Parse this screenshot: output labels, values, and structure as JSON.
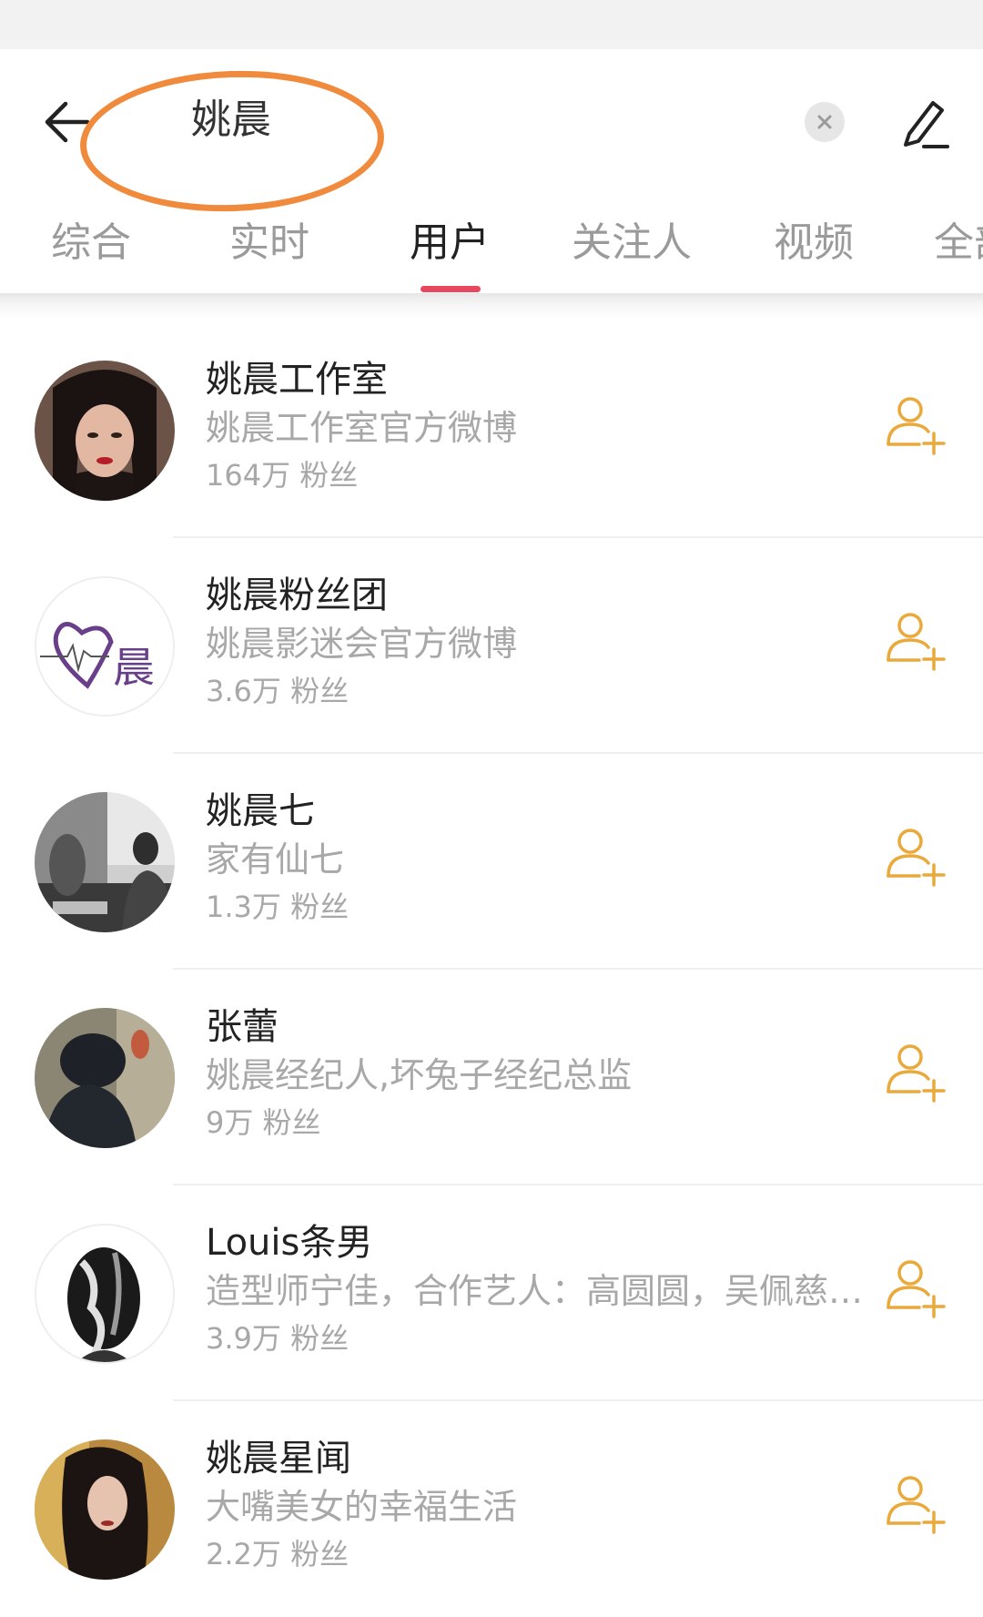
{
  "search": {
    "query": "姚晨"
  },
  "tabs": [
    {
      "label": "综合"
    },
    {
      "label": "实时"
    },
    {
      "label": "用户"
    },
    {
      "label": "关注人"
    },
    {
      "label": "视频"
    },
    {
      "label": "全部"
    }
  ],
  "users": [
    {
      "name": "姚晨工作室",
      "desc": "姚晨工作室官方微博",
      "fans": "164万 粉丝"
    },
    {
      "name": "姚晨粉丝团",
      "desc": "姚晨影迷会官方微博",
      "fans": "3.6万 粉丝"
    },
    {
      "name": "姚晨七",
      "desc": "家有仙七",
      "fans": "1.3万 粉丝"
    },
    {
      "name": "张蕾",
      "desc": "姚晨经纪人,坏兔子经纪总监",
      "fans": "9万 粉丝"
    },
    {
      "name": "Louis条男",
      "desc": "造型师宁佳，合作艺人：高圆圆，吴佩慈…",
      "fans": "3.9万 粉丝"
    },
    {
      "name": "姚晨星闻",
      "desc": "大嘴美女的幸福生活",
      "fans": "2.2万 粉丝"
    }
  ],
  "colors": {
    "accent": "#e8485f",
    "follow": "#e9a93b",
    "highlight": "#f08a3c"
  },
  "icons": {
    "back": "arrow-left-icon",
    "clear": "close-icon",
    "edit": "pencil-icon",
    "follow": "add-user-icon"
  }
}
